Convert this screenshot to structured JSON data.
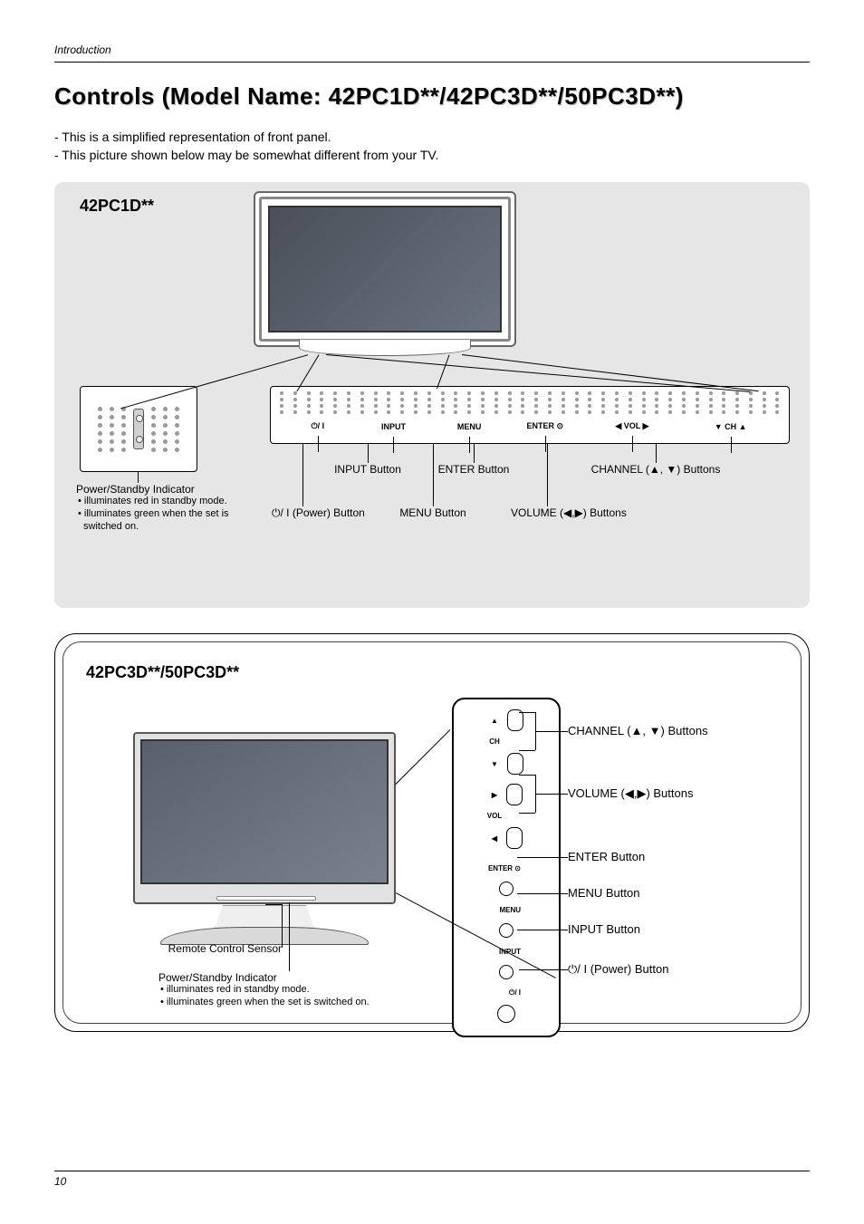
{
  "header": {
    "section": "Introduction"
  },
  "title": "Controls (Model Name: 42PC1D**/42PC3D**/50PC3D**)",
  "intro": [
    "- This is a simplified representation of front panel.",
    "- This picture shown below may be somewhat different from your TV."
  ],
  "box1": {
    "model": "42PC1D**",
    "strip": {
      "power_sym": "⏻/ I",
      "input": "INPUT",
      "menu": "MENU",
      "enter": "ENTER ⊙",
      "vol": "◀  VOL  ▶",
      "ch": "▼  CH  ▲"
    },
    "callouts": {
      "power_indicator_title": "Power/Standby Indicator",
      "power_indicator_b1": "illuminates red in standby mode.",
      "power_indicator_b2": "illuminates green when the set is switched on.",
      "power_btn": "⏻/ I (Power) Button",
      "input_btn": "INPUT Button",
      "menu_btn": "MENU Button",
      "enter_btn": "ENTER Button",
      "volume_btn": "VOLUME (◀,▶) Buttons",
      "channel_btn": "CHANNEL (▲, ▼) Buttons"
    }
  },
  "box2": {
    "model": "42PC3D**/50PC3D**",
    "panel": {
      "ch": "CH",
      "vol": "VOL",
      "enter": "ENTER ⊙",
      "menu": "MENU",
      "input": "INPUT",
      "power_sym": "⏻/ I",
      "up": "▲",
      "down": "▼",
      "left": "◀",
      "right": "▶"
    },
    "right_labels": {
      "channel": "CHANNEL (▲, ▼) Buttons",
      "volume": "VOLUME (◀,▶) Buttons",
      "enter": "ENTER Button",
      "menu": "MENU Button",
      "input": "INPUT Button",
      "power": "⏻/ I (Power) Button"
    },
    "bottom": {
      "remote_sensor": "Remote Control Sensor",
      "power_indicator_title": "Power/Standby Indicator",
      "power_indicator_b1": "illuminates red in standby mode.",
      "power_indicator_b2": "illuminates green when the set is switched on."
    }
  },
  "page_number": "10"
}
